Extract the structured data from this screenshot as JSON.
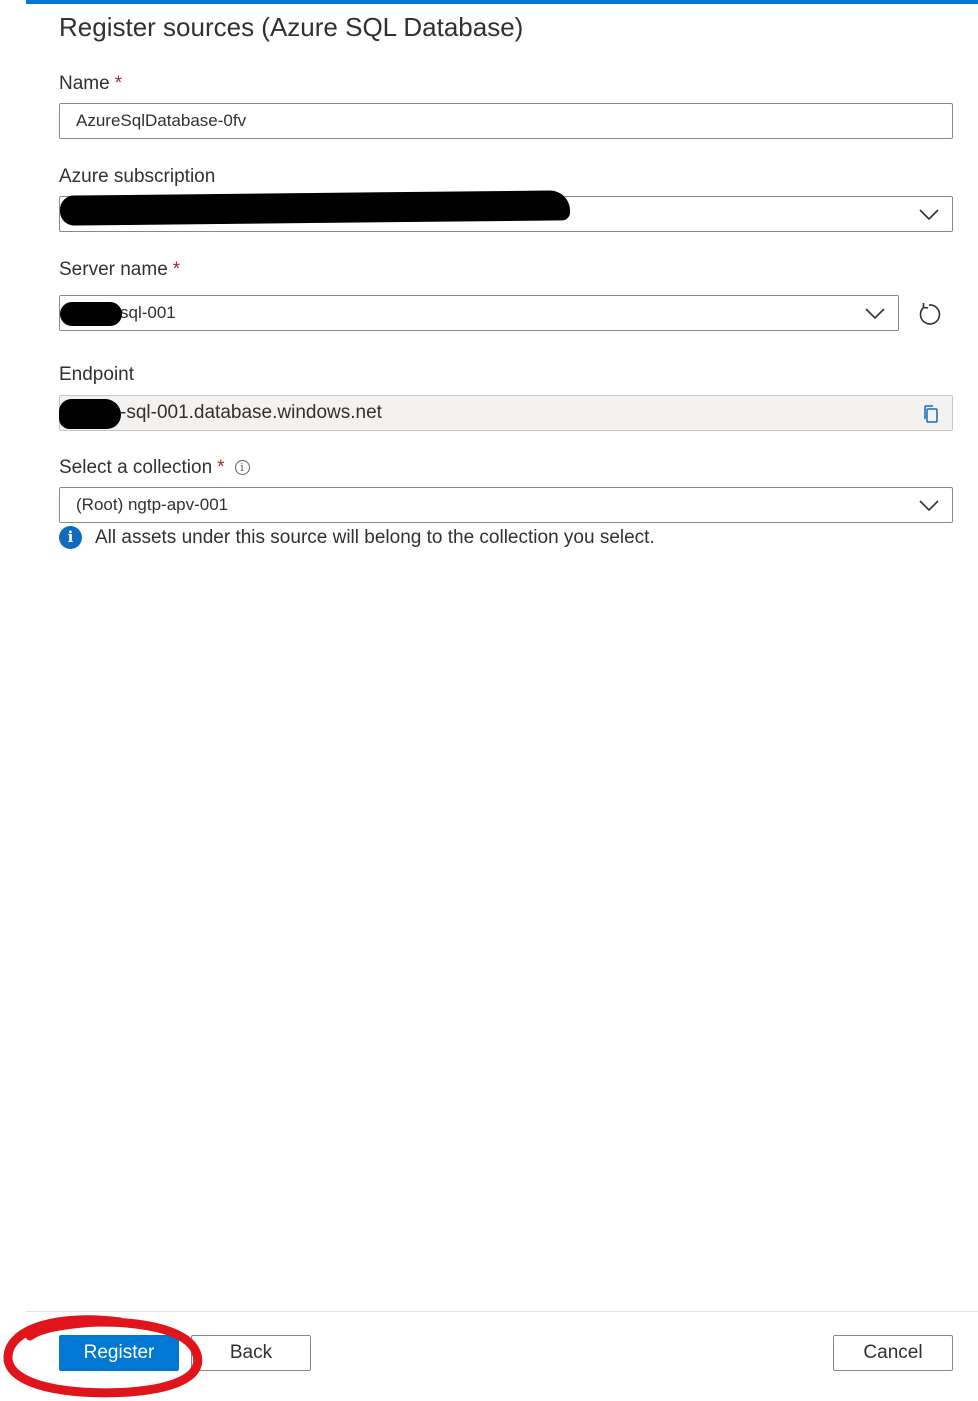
{
  "panel": {
    "title": "Register sources (Azure SQL Database)"
  },
  "fields": {
    "name": {
      "label": "Name",
      "required_mark": "*",
      "value": "AzureSqlDatabase-0fv"
    },
    "subscription": {
      "label": "Azure subscription",
      "value": ""
    },
    "server_name": {
      "label": "Server name",
      "required_mark": "*",
      "value": "sql-001"
    },
    "endpoint": {
      "label": "Endpoint",
      "value": "-sql-001.database.windows.net"
    },
    "collection": {
      "label": "Select a collection",
      "required_mark": "*",
      "info_icon": "i",
      "value": "(Root) ngtp-apv-001"
    }
  },
  "info_message": {
    "icon": "i",
    "text": "All assets under this source will belong to the collection you select."
  },
  "footer": {
    "register_label": "Register",
    "back_label": "Back",
    "cancel_label": "Cancel"
  },
  "colors": {
    "accent": "#0078d4",
    "required": "#a4262c",
    "annotation": "#e0141b"
  },
  "icons": {
    "dropdown": "chevron-down-icon",
    "refresh": "refresh-icon",
    "copy": "copy-icon",
    "info": "info-icon"
  }
}
